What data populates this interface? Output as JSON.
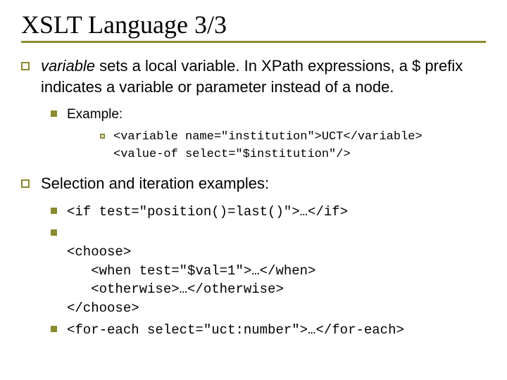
{
  "title": "XSLT Language 3/3",
  "p1": {
    "em": "variable",
    "rest": " sets a local variable. In XPath expressions, a $ prefix indicates a variable or parameter instead of a node."
  },
  "example_label": "Example:",
  "example_code_l1": "<variable name=\"institution\">UCT</variable>",
  "example_code_l2": "<value-of select=\"$institution\"/>",
  "p2": "Selection and iteration examples:",
  "sel1": "<if test=\"position()=last()\">…</if>",
  "sel2_l1": "<choose>",
  "sel2_l2": "   <when test=\"$val=1\">…</when>",
  "sel2_l3": "   <otherwise>…</otherwise>",
  "sel2_l4": "</choose>",
  "sel3": "<for-each select=\"uct:number\">…</for-each>"
}
